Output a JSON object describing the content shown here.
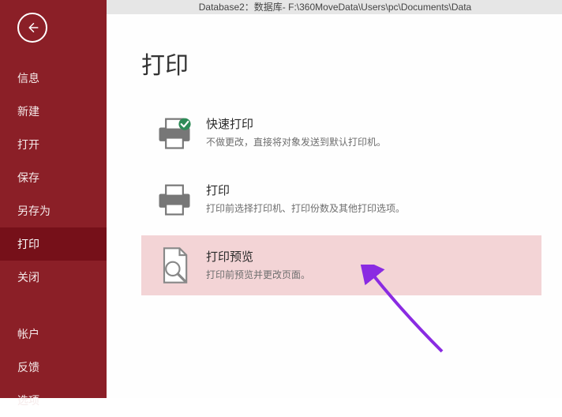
{
  "topbar": {
    "title": "Database2：数据库- F:\\360MoveData\\Users\\pc\\Documents\\Data"
  },
  "sidebar": {
    "items": [
      {
        "label": "信息"
      },
      {
        "label": "新建"
      },
      {
        "label": "打开"
      },
      {
        "label": "保存"
      },
      {
        "label": "另存为"
      },
      {
        "label": "打印",
        "selected": true
      },
      {
        "label": "关闭"
      }
    ],
    "lower_items": [
      {
        "label": "帐户"
      },
      {
        "label": "反馈"
      },
      {
        "label": "选项"
      }
    ]
  },
  "page": {
    "title": "打印",
    "options": [
      {
        "title": "快速打印",
        "desc": "不做更改，直接将对象发送到默认打印机。"
      },
      {
        "title": "打印",
        "desc": "打印前选择打印机、打印份数及其他打印选项。"
      },
      {
        "title": "打印预览",
        "desc": "打印前预览并更改页面。",
        "selected": true
      }
    ]
  }
}
